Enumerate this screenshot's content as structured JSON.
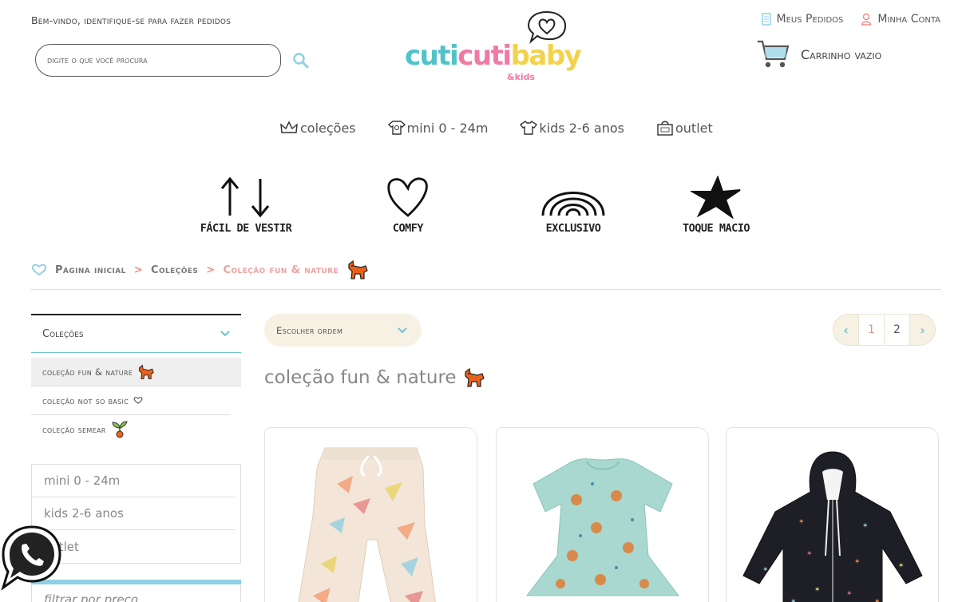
{
  "header": {
    "welcome": "Bem-vindo, identifique-se para fazer pedidos",
    "search_placeholder": "digite o que você procura",
    "logo": {
      "part1": "cuti",
      "part2": "cuti",
      "part3": "baby",
      "kids": "&kids"
    },
    "my_orders": "Meus Pedidos",
    "my_account": "Minha Conta",
    "cart": "Carrinho vazio"
  },
  "nav": [
    {
      "label": "coleções",
      "icon": "crown-icon"
    },
    {
      "label": "mini 0 - 24m",
      "icon": "onesie-icon"
    },
    {
      "label": "kids 2-6 anos",
      "icon": "tshirt-icon"
    },
    {
      "label": "outlet",
      "icon": "shopping-bag-icon"
    }
  ],
  "features": [
    {
      "label": "FÁCIL DE VESTIR",
      "icon": "arrows-icon"
    },
    {
      "label": "COMFY",
      "icon": "heart-icon"
    },
    {
      "label": "EXCLUSIVO",
      "icon": "rainbow-icon"
    },
    {
      "label": "TOQUE MACIO",
      "icon": "star-icon"
    }
  ],
  "breadcrumb": {
    "home": "Página inicial",
    "collections": "Coleções",
    "current": "Coleção fun & nature"
  },
  "sidebar": {
    "header": "Coleções",
    "sub_items": [
      {
        "label": "coleção fun & nature",
        "icon": "fox-icon"
      },
      {
        "label": "coleção not so basic",
        "icon": "heart-outline-icon"
      },
      {
        "label": "coleção semear",
        "icon": "sprout-icon"
      }
    ],
    "categories": [
      "mini 0 - 24m",
      "kids 2-6 anos",
      "outlet"
    ],
    "filter_label": "filtrar por preço"
  },
  "sort": {
    "label": "Escolher ordem"
  },
  "pagination": {
    "pages": [
      "1",
      "2"
    ],
    "current": "1"
  },
  "page_title": "coleção fun & nature",
  "products": [
    {
      "name": "product-pants-dinosaur"
    },
    {
      "name": "product-bodysuit-sloth"
    },
    {
      "name": "product-hoodie-stars"
    }
  ],
  "colors": {
    "teal": "#4fc3c8",
    "pink": "#f07aa3",
    "yellow": "#f2d24a",
    "sort_bg": "#f6f1e3",
    "breadcrumb_current": "#f0a1a1",
    "fox": "#e8621c"
  }
}
